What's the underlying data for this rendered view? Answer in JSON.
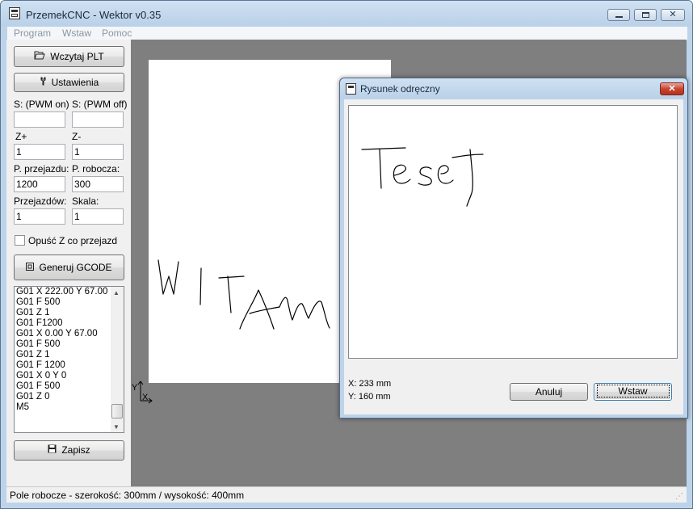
{
  "window": {
    "title": "PrzemekCNC - Wektor v0.35"
  },
  "menu": [
    "Program",
    "Wstaw",
    "Pomoc"
  ],
  "sidebar": {
    "load_button": "Wczytaj PLT",
    "settings_button": "Ustawienia",
    "pwm_on_label": "S: (PWM on)",
    "pwm_off_label": "S: (PWM off)",
    "pwm_on_value": "",
    "pwm_off_value": "",
    "z_plus_label": "Z+",
    "z_minus_label": "Z-",
    "z_plus_value": "1",
    "z_minus_value": "1",
    "travel_speed_label": "P. przejazdu:",
    "work_speed_label": "P. robocza:",
    "travel_speed_value": "1200",
    "work_speed_value": "300",
    "passes_label": "Przejazdów:",
    "scale_label": "Skala:",
    "passes_value": "1",
    "scale_value": "1",
    "lower_z_label": "Opuść Z co przejazd",
    "lower_z_checked": false,
    "generate_button": "Generuj GCODE",
    "gcode_lines": [
      "G01 X 222.00 Y 67.00",
      "G01 F 500",
      "G01 Z 1",
      "G01 F1200",
      "G01 X 0.00 Y 67.00",
      "G01 F 500",
      "G01 Z 1",
      "G01 F 1200",
      "G01 X 0 Y 0",
      "G01 F 500",
      "G01 Z 0",
      "M5"
    ],
    "save_button": "Zapisz"
  },
  "workspace": {
    "axis_y_label": "Y",
    "axis_x_label": "X"
  },
  "status": {
    "text": "Pole robocze - szerokość: 300mm / wysokość: 400mm"
  },
  "dialog": {
    "title": "Rysunek odręczny",
    "coord_x": "X: 233 mm",
    "coord_y": "Y: 160 mm",
    "cancel_button": "Anuluj",
    "insert_button": "Wstaw"
  },
  "colors": {
    "workspace_bg": "#7f7f7f",
    "window_frame": "#bcd3ea",
    "close_button": "#c7452f"
  }
}
